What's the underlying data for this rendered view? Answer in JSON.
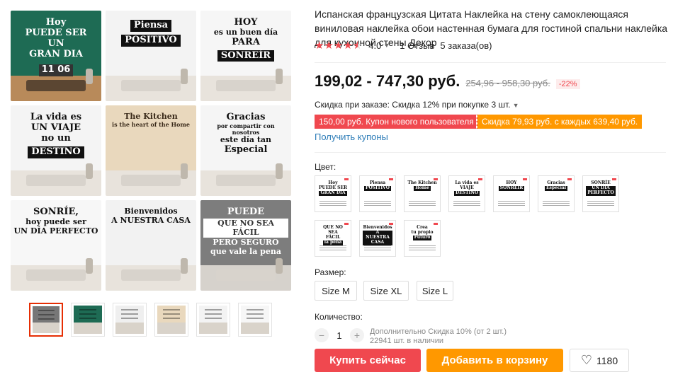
{
  "product": {
    "title": "Испанская французская Цитата Наклейка на стену самоклеющаяся виниловая наклейка обои настенная бумага для гостиной спальни наклейка для кухонной стены Декор",
    "rating_value": "4.0",
    "rating_stars": 4,
    "reviews": "1 Отзыв",
    "orders": "5 заказа(ов)"
  },
  "gallery": {
    "tiles": [
      {
        "lines": [
          "Hoy",
          "PUEDE SER",
          "UN",
          "GRAN DIA"
        ],
        "banner_index": -1,
        "wall": "#1e6b54",
        "text_color": "#ffffff",
        "extra": "11 06"
      },
      {
        "lines": [
          "Piensa",
          "POSITIVO"
        ],
        "banner_index": -2,
        "wall": "#f3f3f3",
        "text_color": "#111111",
        "extra": ""
      },
      {
        "lines": [
          "HOY",
          "es un buen día",
          "PARA",
          "SONREÍR"
        ],
        "banner_index": 3,
        "wall": "#f6f6f6",
        "text_color": "#111111",
        "extra": ""
      },
      {
        "lines": [
          "La vida es",
          "UN VIAJE",
          "no un",
          "DESTINO"
        ],
        "banner_index": 3,
        "wall": "#f4f4f4",
        "text_color": "#111111",
        "extra": ""
      },
      {
        "lines": [
          "The Kitchen",
          "is the heart of the Home"
        ],
        "banner_index": -1,
        "wall": "#e9d8bd",
        "text_color": "#3a2a1a",
        "extra": ""
      },
      {
        "lines": [
          "Gracias",
          "por compartir con nosotros",
          "este día tan",
          "Especial"
        ],
        "banner_index": -1,
        "wall": "#f5f5f5",
        "text_color": "#111111",
        "extra": ""
      },
      {
        "lines": [
          "SONRÍE,",
          "hoy puede ser",
          "UN DÍA PERFECTO"
        ],
        "banner_index": -1,
        "wall": "#f7f7f7",
        "text_color": "#111111",
        "extra": ""
      },
      {
        "lines": [
          "Bienvenidos",
          "A NUESTRA CASA"
        ],
        "banner_index": -1,
        "wall": "#f2f2f2",
        "text_color": "#111111",
        "extra": ""
      },
      {
        "lines": [
          "PUEDE",
          "QUE NO SEA FÁCIL",
          "PERO SEGURO",
          "que vale la pena"
        ],
        "banner_index": 1,
        "wall": "#7d7d7d",
        "text_color": "#ffffff",
        "extra": ""
      }
    ],
    "thumbs": [
      {
        "active": true,
        "color": "#777777"
      },
      {
        "active": false,
        "color": "#1e6b54"
      },
      {
        "active": false,
        "color": "#efefef"
      },
      {
        "active": false,
        "color": "#e9d8bd"
      },
      {
        "active": false,
        "color": "#f3f3f3"
      },
      {
        "active": false,
        "color": "#f6f6f6"
      }
    ]
  },
  "pricing": {
    "current": "199,02 - 747,30 руб.",
    "old": "254,96 - 958,30 руб.",
    "discount": "-22%",
    "bulk": "Скидка при заказе: Скидка 12% при покупке 3 шт."
  },
  "coupons": {
    "new_user": "150,00 руб. Купон нового пользователя",
    "store": "Скидка 79,93 руб. с каждых 639,40 руб.",
    "get": "Получить купоны"
  },
  "color": {
    "label": "Цвет:",
    "swatches": [
      {
        "lines": [
          "Hoy",
          "PUEDE SER",
          "GRAN DIA"
        ]
      },
      {
        "lines": [
          "Piensa",
          "POSITIVO"
        ]
      },
      {
        "lines": [
          "The Kitchen",
          "Home"
        ]
      },
      {
        "lines": [
          "La vida es",
          "VIAJE",
          "DESTINO"
        ]
      },
      {
        "lines": [
          "HOY",
          "SONREÍR"
        ]
      },
      {
        "lines": [
          "Gracias",
          "Especial"
        ]
      },
      {
        "lines": [
          "SONRÍE",
          "UN DÍA PERFECTO"
        ]
      },
      {
        "lines": [
          "QUE NO SEA",
          "FÁCIL",
          "la pena"
        ]
      },
      {
        "lines": [
          "Bienvenidos",
          "A NUESTRA CASA"
        ]
      },
      {
        "lines": [
          "Crea",
          "tu propio",
          "Futuro"
        ]
      }
    ]
  },
  "size": {
    "label": "Размер:",
    "options": [
      "Size M",
      "Size XL",
      "Size L"
    ]
  },
  "quantity": {
    "label": "Количество:",
    "value": "1",
    "minus": "−",
    "plus": "+",
    "note": "Дополнительно Скидка 10% (от 2 шт.)",
    "stock": "22941 шт. в наличии"
  },
  "actions": {
    "buy": "Купить сейчас",
    "cart": "Добавить в корзину",
    "wishlist_count": "1180"
  },
  "icons": {
    "chevron": "chevron-down-icon",
    "heart": "heart-icon",
    "star": "star-icon"
  },
  "colors": {
    "accent_red": "#f0484f",
    "accent_orange": "#ff9800",
    "link_blue": "#2e7db8"
  }
}
